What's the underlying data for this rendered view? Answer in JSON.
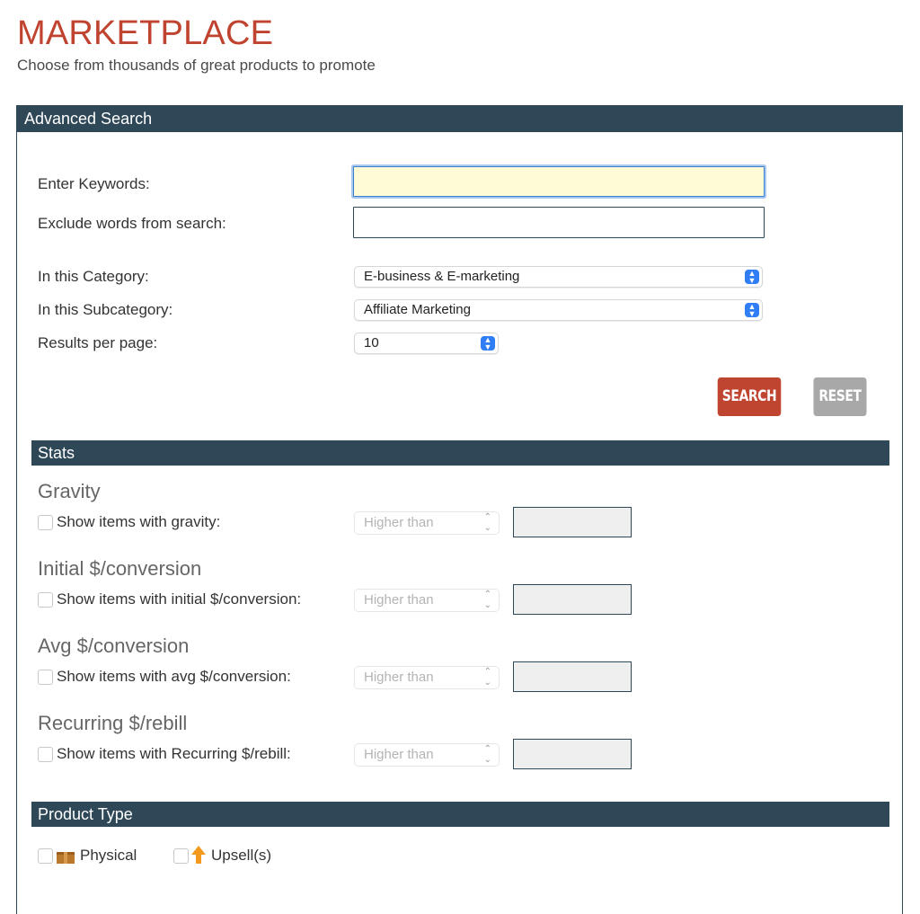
{
  "page": {
    "title": "MARKETPLACE",
    "subtitle": "Choose from thousands of great products to promote"
  },
  "advanced_search": {
    "heading": "Advanced Search",
    "keywords_label": "Enter Keywords:",
    "keywords_value": "",
    "exclude_label": "Exclude words from search:",
    "exclude_value": "",
    "category_label": "In this Category:",
    "category_value": "E-business & E-marketing",
    "subcategory_label": "In this Subcategory:",
    "subcategory_value": "Affiliate Marketing",
    "results_label": "Results per page:",
    "results_value": "10",
    "search_button": "SEARCH",
    "reset_button": "RESET"
  },
  "stats": {
    "heading": "Stats",
    "groups": [
      {
        "title": "Gravity",
        "checkbox_label": "Show items with gravity:",
        "comparator": "Higher than",
        "value": ""
      },
      {
        "title": "Initial $/conversion",
        "checkbox_label": "Show items with initial $/conversion:",
        "comparator": "Higher than",
        "value": ""
      },
      {
        "title": "Avg $/conversion",
        "checkbox_label": "Show items with avg $/conversion:",
        "comparator": "Higher than",
        "value": ""
      },
      {
        "title": "Recurring $/rebill",
        "checkbox_label": "Show items with Recurring $/rebill:",
        "comparator": "Higher than",
        "value": ""
      }
    ]
  },
  "product_type": {
    "heading": "Product Type",
    "options": [
      {
        "label": "Physical",
        "icon": "box-icon",
        "checked": false
      },
      {
        "label": "Upsell(s)",
        "icon": "up-arrow-icon",
        "checked": false
      }
    ]
  },
  "colors": {
    "title": "#c0432f",
    "header_bar": "#2f4858",
    "search_button": "#bf4530",
    "reset_button": "#a8a8a8",
    "select_arrow": "#2f7ef6"
  }
}
